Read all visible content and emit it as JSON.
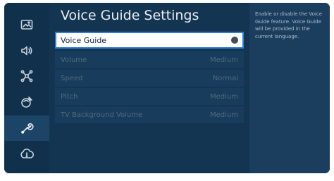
{
  "header": {
    "title": "Voice Guide Settings"
  },
  "sidebar": {
    "items": [
      {
        "name": "picture-icon",
        "active": false
      },
      {
        "name": "sound-icon",
        "active": false
      },
      {
        "name": "network-icon",
        "active": false
      },
      {
        "name": "broadcast-icon",
        "active": false
      },
      {
        "name": "wrench-icon",
        "active": true
      },
      {
        "name": "support-icon",
        "active": false
      }
    ]
  },
  "settings": {
    "voice_guide": {
      "label": "Voice Guide",
      "toggle_state": "off"
    },
    "volume": {
      "label": "Volume",
      "value": "Medium"
    },
    "speed": {
      "label": "Speed",
      "value": "Normal"
    },
    "pitch": {
      "label": "Pitch",
      "value": "Medium"
    },
    "tv_background_volume": {
      "label": "TV Background Volume",
      "value": "Medium"
    }
  },
  "help": {
    "text": "Enable or disable the Voice Guide feature. Voice Guide will be provided in the current language."
  },
  "colors": {
    "background": "#143552",
    "sidebar": "#10304b",
    "help_panel": "#1b3e5e",
    "focus_border": "#2f7ed4",
    "disabled_text": "#51697e"
  }
}
